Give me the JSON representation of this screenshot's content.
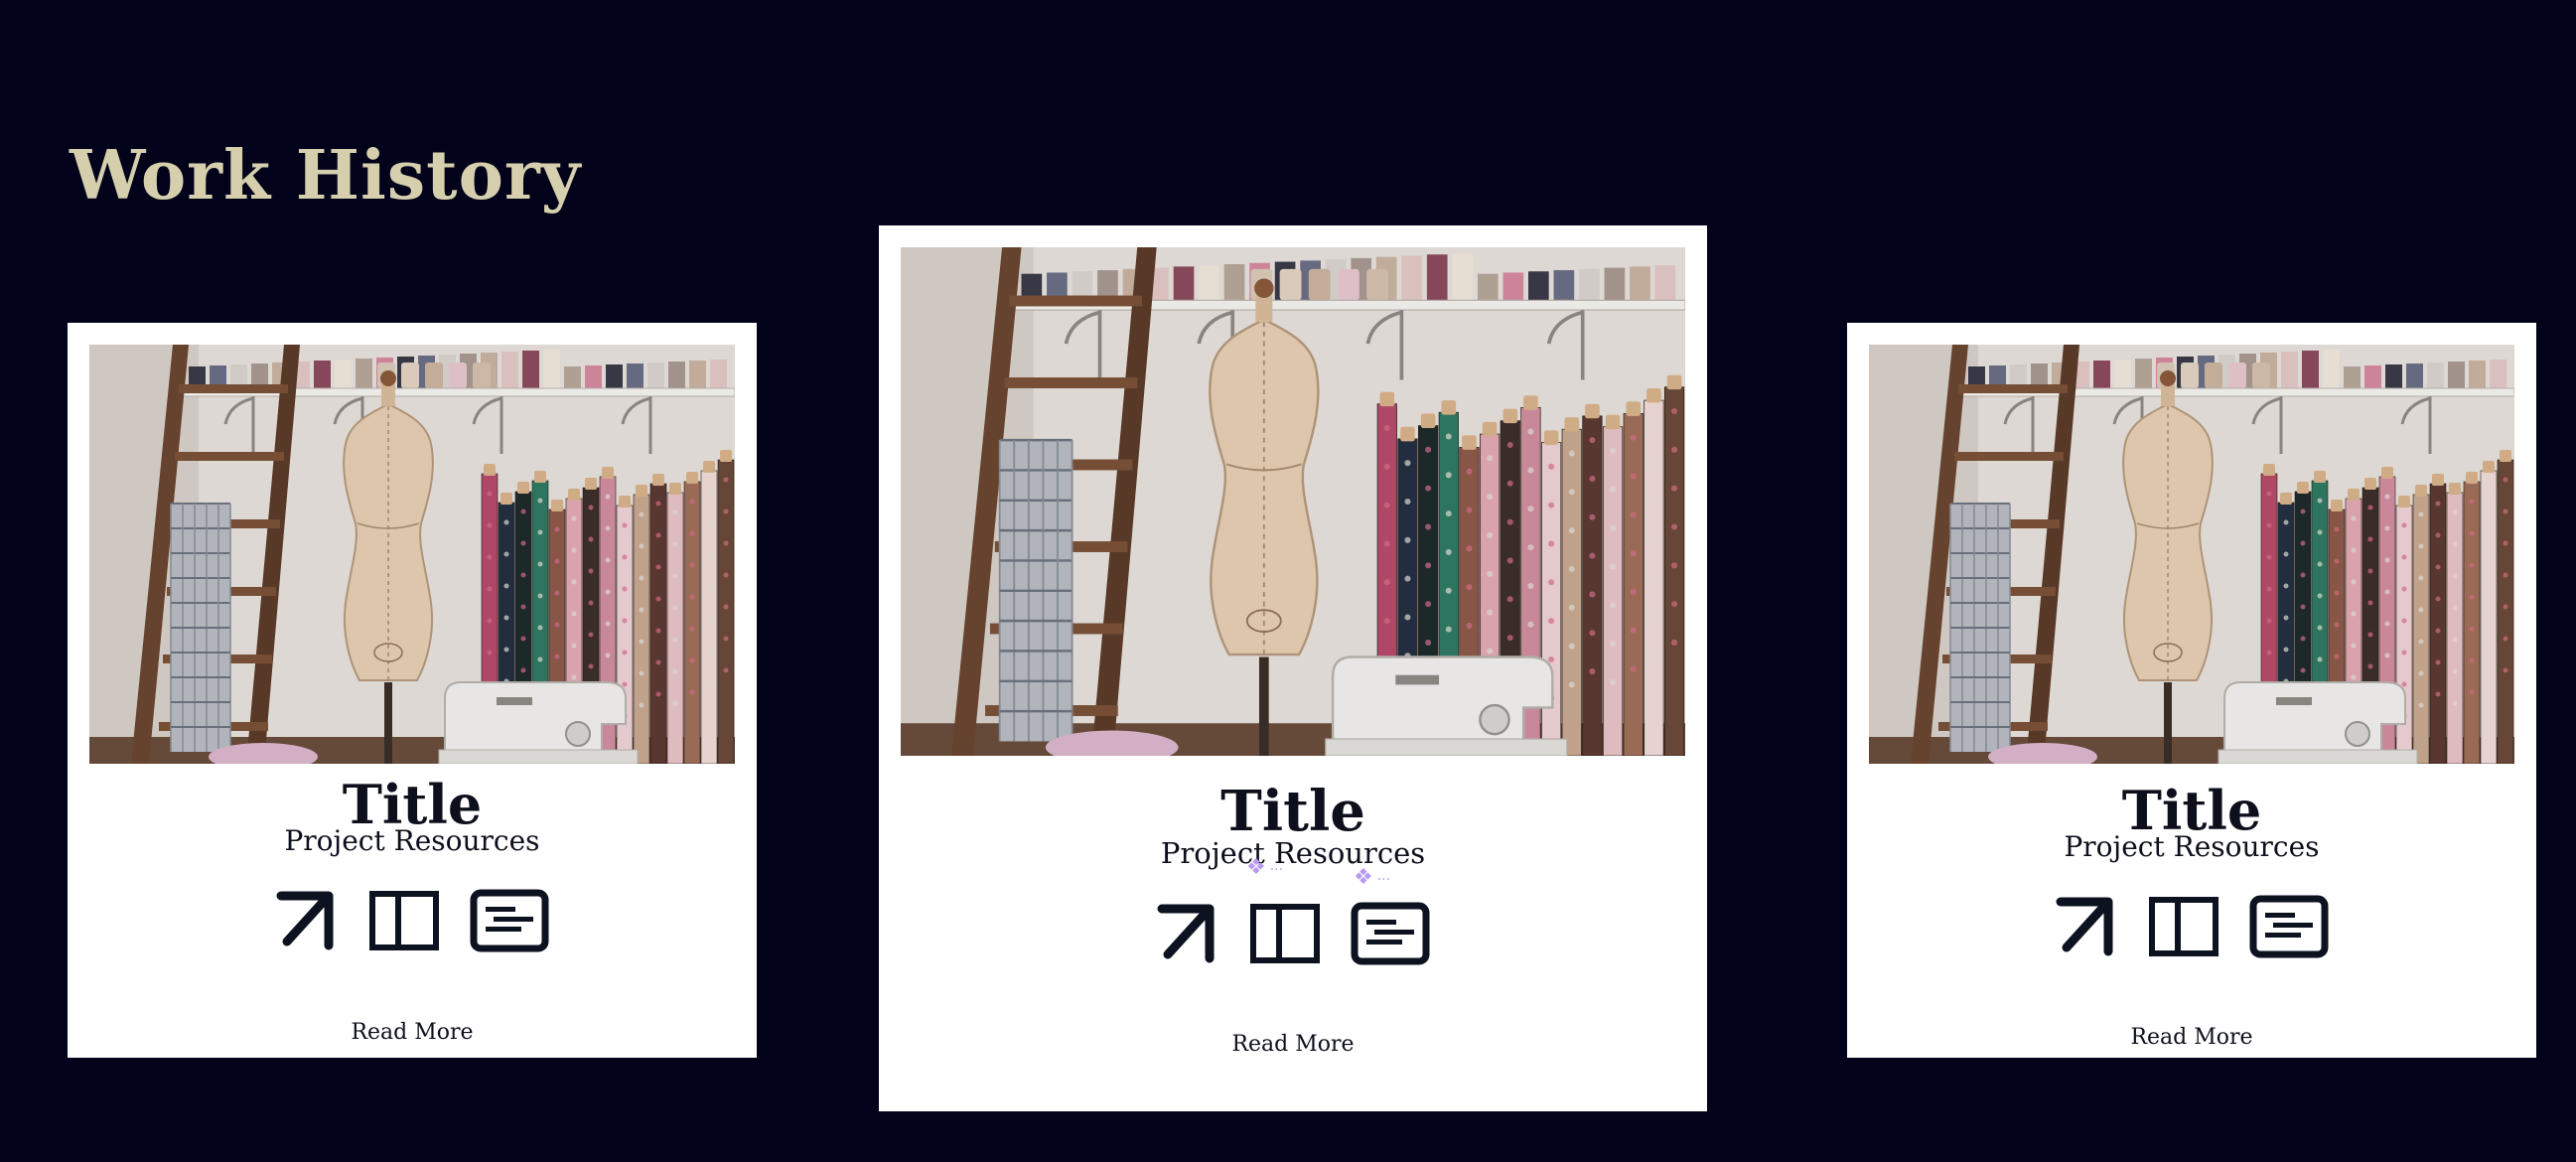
{
  "page": {
    "heading": "Work History",
    "background_color": "#02021a",
    "heading_color": "#d6cfae"
  },
  "cards": [
    {
      "title": "Title",
      "subtitle": "Project Resources",
      "read_more": "Read More",
      "image_alt": "sewing studio with dress form, fabric rolls, ladder and sewing machine",
      "icons": [
        "arrow-up-right-icon",
        "book-open-icon",
        "slides-icon"
      ]
    },
    {
      "title": "Title",
      "subtitle": "Project Resources",
      "read_more": "Read More",
      "image_alt": "sewing studio with dress form, fabric rolls, ladder and sewing machine",
      "icons": [
        "arrow-up-right-icon",
        "book-open-icon",
        "slides-icon"
      ],
      "sparkles": [
        "❖",
        "❖"
      ]
    },
    {
      "title": "Title",
      "subtitle": "Project Resources",
      "read_more": "Read More",
      "image_alt": "sewing studio with dress form, fabric rolls, ladder and sewing machine",
      "icons": [
        "arrow-up-right-icon",
        "book-open-icon",
        "slides-icon"
      ]
    }
  ]
}
